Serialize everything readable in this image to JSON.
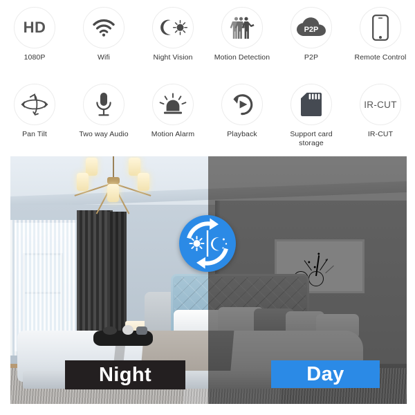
{
  "features": {
    "row1": [
      {
        "label": "1080P",
        "icon": "hd-icon",
        "glyph": "HD"
      },
      {
        "label": "Wifi",
        "icon": "wifi-icon"
      },
      {
        "label": "Night Vision",
        "icon": "night-vision-icon"
      },
      {
        "label": "Motion Detection",
        "icon": "motion-detection-icon"
      },
      {
        "label": "P2P",
        "icon": "p2p-cloud-icon",
        "glyph": "P2P"
      },
      {
        "label": "Remote Control",
        "icon": "smartphone-icon"
      }
    ],
    "row2": [
      {
        "label": "Pan Tilt",
        "icon": "pan-tilt-icon"
      },
      {
        "label": "Two way Audio",
        "icon": "microphone-icon"
      },
      {
        "label": "Motion Alarm",
        "icon": "alarm-siren-icon"
      },
      {
        "label": "Playback",
        "icon": "playback-replay-icon"
      },
      {
        "label": "Support card storage",
        "icon": "sd-card-icon"
      },
      {
        "label": "IR-CUT",
        "icon": "ir-cut-icon",
        "glyph": "IR-CUT"
      }
    ]
  },
  "comparison": {
    "left_label": "Night",
    "right_label": "Day",
    "badge_icon": "day-night-switch-icon"
  },
  "colors": {
    "accent_blue": "#2b8ae6",
    "night_banner": "#231f20",
    "icon_gray": "#555555",
    "label_text": "#333333",
    "circle_border": "#ececec"
  }
}
